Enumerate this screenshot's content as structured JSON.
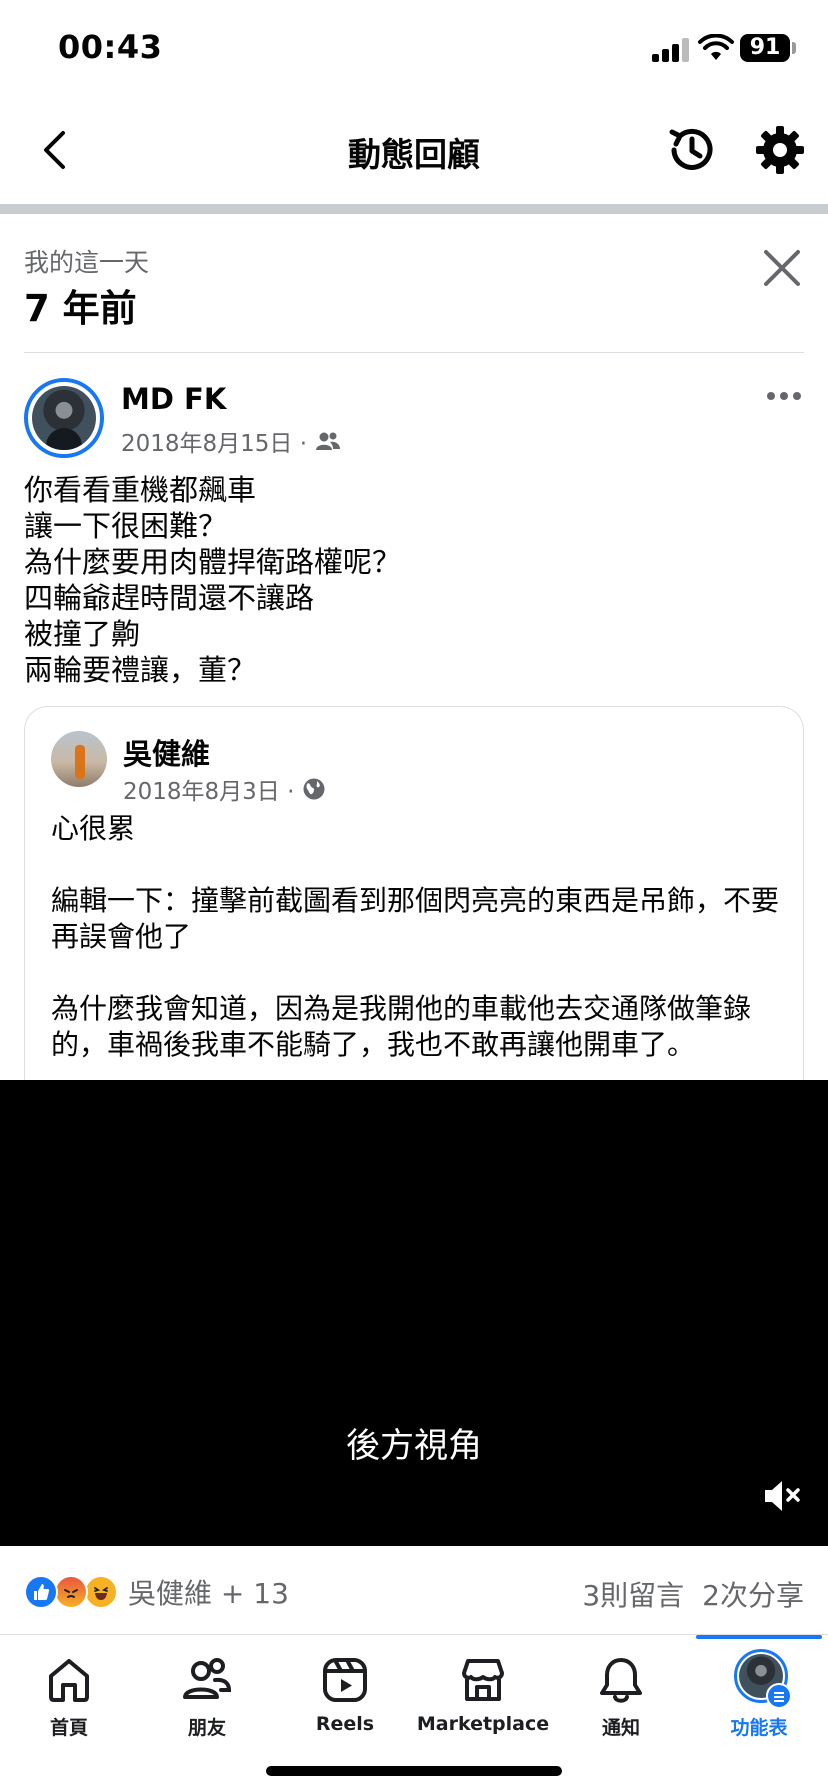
{
  "status_bar": {
    "time": "00:43",
    "battery": "91"
  },
  "header": {
    "title": "動態回顧"
  },
  "memory": {
    "subtitle": "我的這一天",
    "title": "7 年前"
  },
  "post": {
    "author": "MD FK",
    "date": "2018年8月15日 ·",
    "audience_icon": "friends-icon",
    "text": "你看看重機都飆車\n讓一下很困難？\n為什麼要用肉體捍衛路權呢？\n四輪爺趕時間還不讓路\n被撞了齁\n兩輪要禮讓，董？"
  },
  "shared_post": {
    "author": "吳健維",
    "date": "2018年8月3日 ·",
    "audience_icon": "globe-icon",
    "text": "心很累\n\n編輯一下：撞擊前截圖看到那個閃亮亮的東西是吊飾，不要再誤會他了\n\n為什麼我會知道，因為是我開他的車載他去交通隊做筆錄的，車禍後我車不能騎了，我也不敢再讓他開車了。"
  },
  "video": {
    "caption": "後方視角",
    "muted": true
  },
  "reactions": {
    "names": "吳健維 + 13",
    "comments": "3則留言",
    "shares": "2次分享"
  },
  "tabs": [
    {
      "label": "首頁",
      "icon": "home-icon"
    },
    {
      "label": "朋友",
      "icon": "friends-icon"
    },
    {
      "label": "Reels",
      "icon": "reels-icon"
    },
    {
      "label": "Marketplace",
      "icon": "marketplace-icon"
    },
    {
      "label": "通知",
      "icon": "bell-icon"
    },
    {
      "label": "功能表",
      "icon": "menu-avatar"
    }
  ],
  "colors": {
    "accent": "#1877f2",
    "secondary_text": "#65676b",
    "divider": "#c9ccd1"
  }
}
